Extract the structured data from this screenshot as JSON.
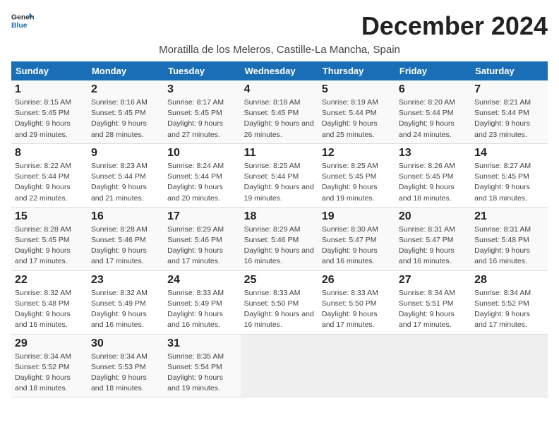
{
  "header": {
    "logo_general": "General",
    "logo_blue": "Blue",
    "month_title": "December 2024",
    "location": "Moratilla de los Meleros, Castille-La Mancha, Spain"
  },
  "weekdays": [
    "Sunday",
    "Monday",
    "Tuesday",
    "Wednesday",
    "Thursday",
    "Friday",
    "Saturday"
  ],
  "weeks": [
    [
      {
        "day": "1",
        "sunrise": "8:15 AM",
        "sunset": "5:45 PM",
        "daylight": "9 hours and 29 minutes."
      },
      {
        "day": "2",
        "sunrise": "8:16 AM",
        "sunset": "5:45 PM",
        "daylight": "9 hours and 28 minutes."
      },
      {
        "day": "3",
        "sunrise": "8:17 AM",
        "sunset": "5:45 PM",
        "daylight": "9 hours and 27 minutes."
      },
      {
        "day": "4",
        "sunrise": "8:18 AM",
        "sunset": "5:45 PM",
        "daylight": "9 hours and 26 minutes."
      },
      {
        "day": "5",
        "sunrise": "8:19 AM",
        "sunset": "5:44 PM",
        "daylight": "9 hours and 25 minutes."
      },
      {
        "day": "6",
        "sunrise": "8:20 AM",
        "sunset": "5:44 PM",
        "daylight": "9 hours and 24 minutes."
      },
      {
        "day": "7",
        "sunrise": "8:21 AM",
        "sunset": "5:44 PM",
        "daylight": "9 hours and 23 minutes."
      }
    ],
    [
      {
        "day": "8",
        "sunrise": "8:22 AM",
        "sunset": "5:44 PM",
        "daylight": "9 hours and 22 minutes."
      },
      {
        "day": "9",
        "sunrise": "8:23 AM",
        "sunset": "5:44 PM",
        "daylight": "9 hours and 21 minutes."
      },
      {
        "day": "10",
        "sunrise": "8:24 AM",
        "sunset": "5:44 PM",
        "daylight": "9 hours and 20 minutes."
      },
      {
        "day": "11",
        "sunrise": "8:25 AM",
        "sunset": "5:44 PM",
        "daylight": "9 hours and 19 minutes."
      },
      {
        "day": "12",
        "sunrise": "8:25 AM",
        "sunset": "5:45 PM",
        "daylight": "9 hours and 19 minutes."
      },
      {
        "day": "13",
        "sunrise": "8:26 AM",
        "sunset": "5:45 PM",
        "daylight": "9 hours and 18 minutes."
      },
      {
        "day": "14",
        "sunrise": "8:27 AM",
        "sunset": "5:45 PM",
        "daylight": "9 hours and 18 minutes."
      }
    ],
    [
      {
        "day": "15",
        "sunrise": "8:28 AM",
        "sunset": "5:45 PM",
        "daylight": "9 hours and 17 minutes."
      },
      {
        "day": "16",
        "sunrise": "8:28 AM",
        "sunset": "5:46 PM",
        "daylight": "9 hours and 17 minutes."
      },
      {
        "day": "17",
        "sunrise": "8:29 AM",
        "sunset": "5:46 PM",
        "daylight": "9 hours and 17 minutes."
      },
      {
        "day": "18",
        "sunrise": "8:29 AM",
        "sunset": "5:46 PM",
        "daylight": "9 hours and 16 minutes."
      },
      {
        "day": "19",
        "sunrise": "8:30 AM",
        "sunset": "5:47 PM",
        "daylight": "9 hours and 16 minutes."
      },
      {
        "day": "20",
        "sunrise": "8:31 AM",
        "sunset": "5:47 PM",
        "daylight": "9 hours and 16 minutes."
      },
      {
        "day": "21",
        "sunrise": "8:31 AM",
        "sunset": "5:48 PM",
        "daylight": "9 hours and 16 minutes."
      }
    ],
    [
      {
        "day": "22",
        "sunrise": "8:32 AM",
        "sunset": "5:48 PM",
        "daylight": "9 hours and 16 minutes."
      },
      {
        "day": "23",
        "sunrise": "8:32 AM",
        "sunset": "5:49 PM",
        "daylight": "9 hours and 16 minutes."
      },
      {
        "day": "24",
        "sunrise": "8:33 AM",
        "sunset": "5:49 PM",
        "daylight": "9 hours and 16 minutes."
      },
      {
        "day": "25",
        "sunrise": "8:33 AM",
        "sunset": "5:50 PM",
        "daylight": "9 hours and 16 minutes."
      },
      {
        "day": "26",
        "sunrise": "8:33 AM",
        "sunset": "5:50 PM",
        "daylight": "9 hours and 17 minutes."
      },
      {
        "day": "27",
        "sunrise": "8:34 AM",
        "sunset": "5:51 PM",
        "daylight": "9 hours and 17 minutes."
      },
      {
        "day": "28",
        "sunrise": "8:34 AM",
        "sunset": "5:52 PM",
        "daylight": "9 hours and 17 minutes."
      }
    ],
    [
      {
        "day": "29",
        "sunrise": "8:34 AM",
        "sunset": "5:52 PM",
        "daylight": "9 hours and 18 minutes."
      },
      {
        "day": "30",
        "sunrise": "8:34 AM",
        "sunset": "5:53 PM",
        "daylight": "9 hours and 18 minutes."
      },
      {
        "day": "31",
        "sunrise": "8:35 AM",
        "sunset": "5:54 PM",
        "daylight": "9 hours and 19 minutes."
      },
      null,
      null,
      null,
      null
    ]
  ]
}
